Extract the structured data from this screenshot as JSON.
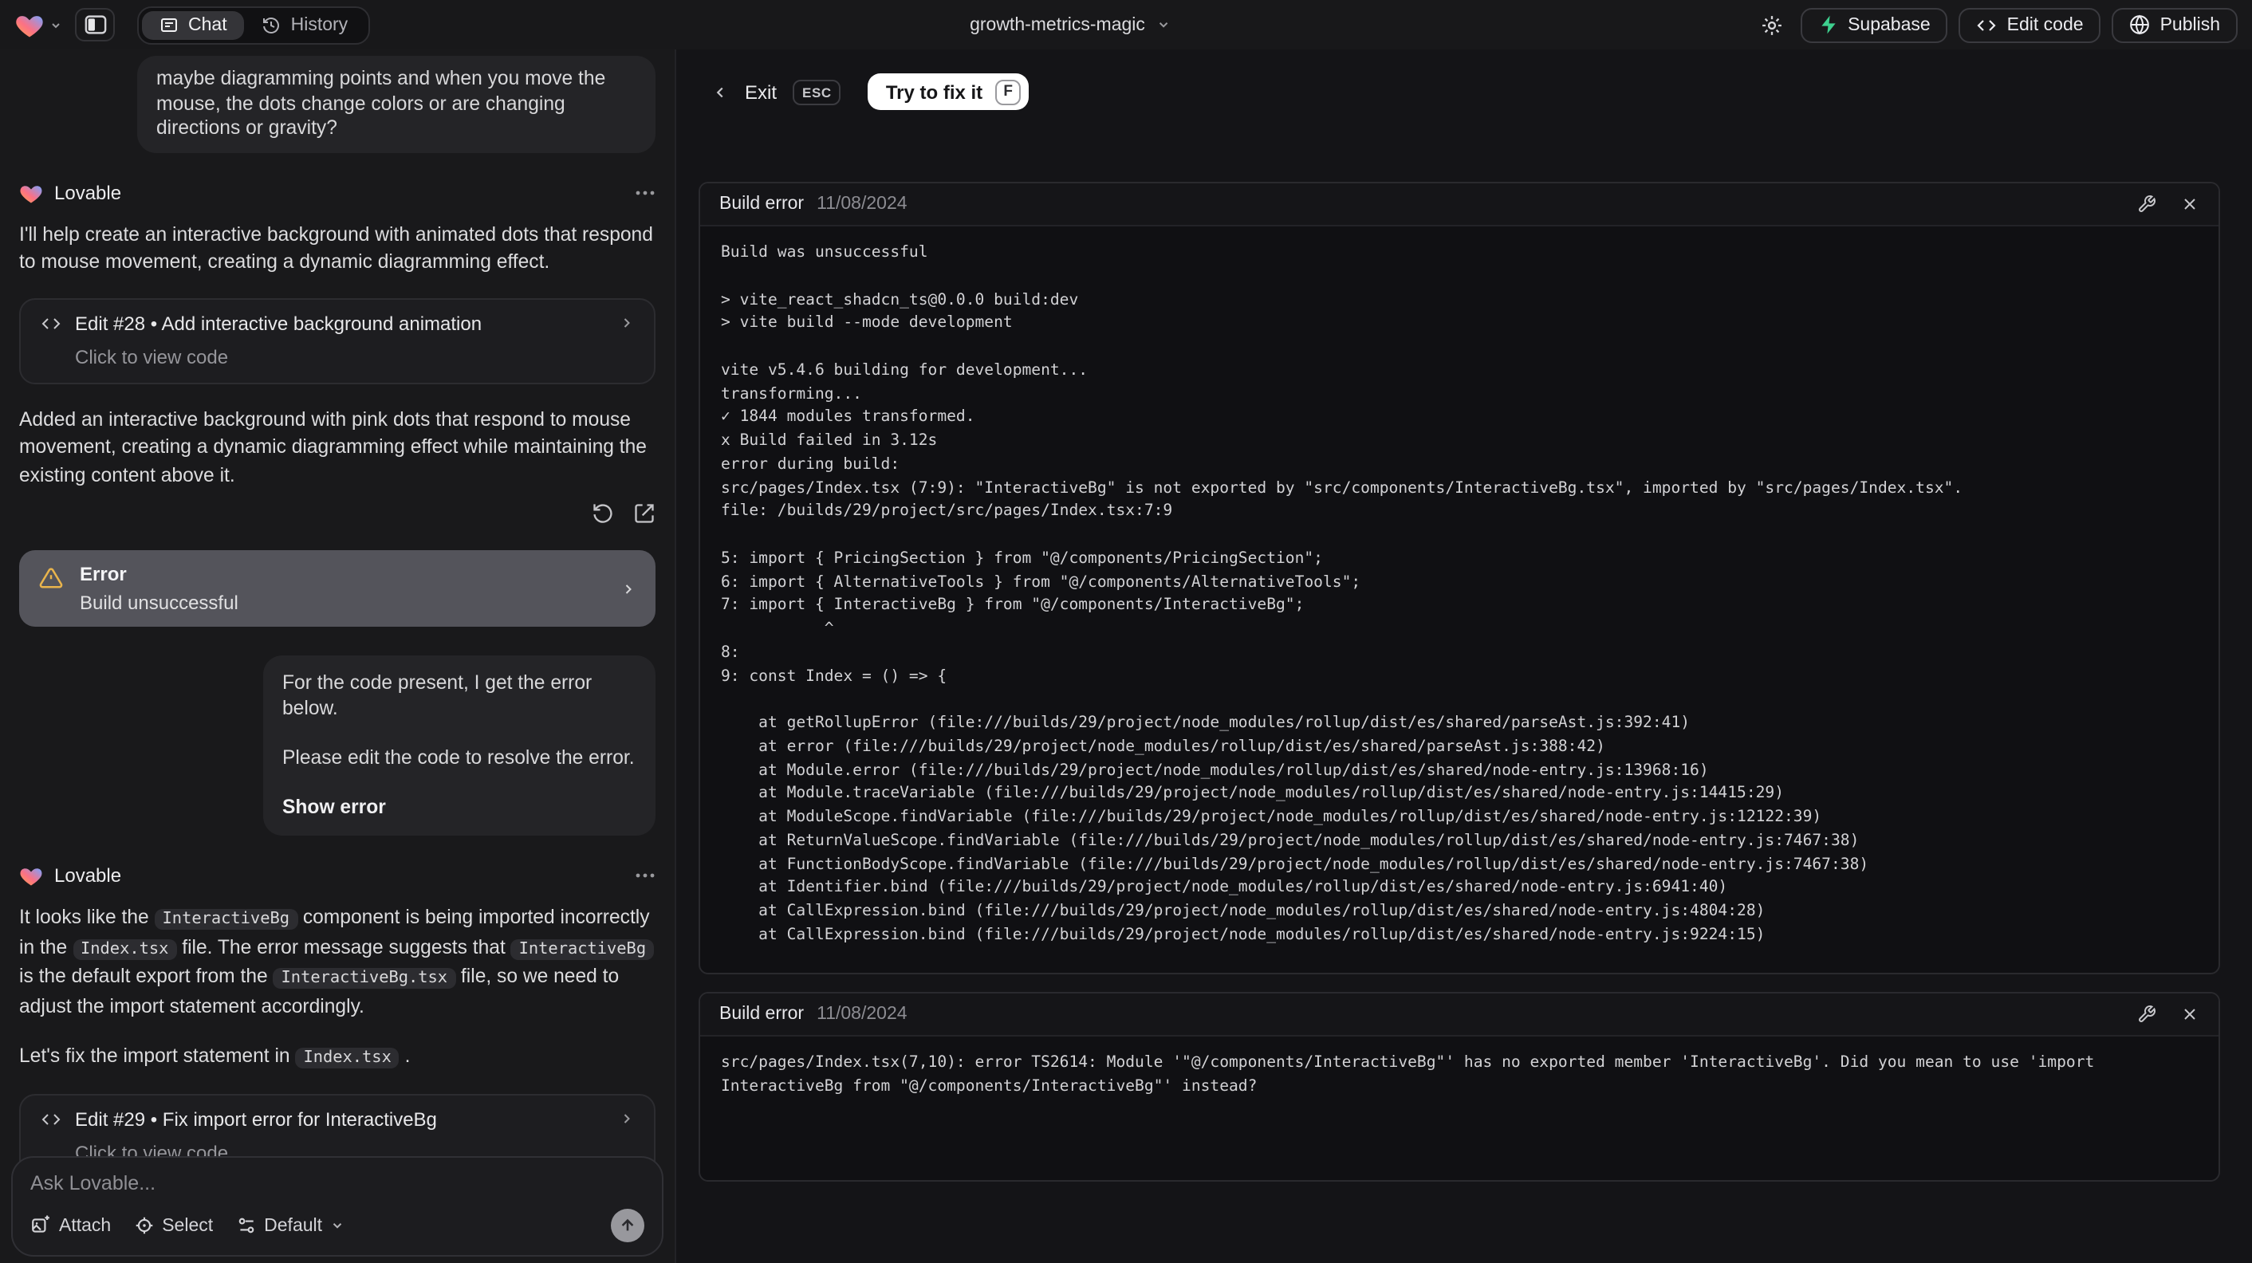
{
  "topbar": {
    "tabs": {
      "chat": "Chat",
      "history": "History"
    },
    "project_name": "growth-metrics-magic",
    "supabase_label": "Supabase",
    "edit_code_label": "Edit code",
    "publish_label": "Publish"
  },
  "colors": {
    "supabase_green": "#3ecf8e",
    "warning_amber": "#e9b44c",
    "fix_button_bg": "#ffffff"
  },
  "chat": {
    "assistant_name": "Lovable",
    "user_message_1": "maybe diagramming points and when you move the mouse, the dots change colors or are changing directions or gravity?",
    "assistant_message_1": {
      "intro": "I'll help create an interactive background with animated dots that respond to mouse movement, creating a dynamic diagramming effect.",
      "edit_title": "Edit #28 • Add interactive background animation",
      "edit_subtitle": "Click to view code",
      "summary": "Added an interactive background with pink dots that respond to mouse movement, creating a dynamic diagramming effect while maintaining the existing content above it."
    },
    "error_card": {
      "title": "Error",
      "subtitle": "Build unsuccessful"
    },
    "user_message_2": {
      "line1": "For the code present, I get the error below.",
      "line2": "Please edit the code to resolve the error.",
      "action": "Show error"
    },
    "assistant_message_2": {
      "parts": [
        "It looks like the ",
        "InteractiveBg",
        " component is being imported incorrectly in the ",
        "Index.tsx",
        " file. The error message suggests that ",
        "InteractiveBg",
        " is the default export from the ",
        "InteractiveBg.tsx",
        " file, so we need to adjust the import statement accordingly."
      ],
      "fix_parts": [
        "Let's fix the import statement in ",
        "Index.tsx",
        " ."
      ],
      "edit_title": "Edit #29 • Fix import error for InteractiveBg",
      "edit_subtitle": "Click to view code"
    },
    "composer": {
      "placeholder": "Ask Lovable...",
      "attach": "Attach",
      "select": "Select",
      "mode": "Default"
    }
  },
  "error_view": {
    "exit_label": "Exit",
    "esc_key": "ESC",
    "fix_label": "Try to fix it",
    "fix_key": "F",
    "panel_1": {
      "title": "Build error",
      "date": "11/08/2024",
      "log": "Build was unsuccessful\n\n> vite_react_shadcn_ts@0.0.0 build:dev\n> vite build --mode development\n\nvite v5.4.6 building for development...\ntransforming...\n✓ 1844 modules transformed.\nx Build failed in 3.12s\nerror during build:\nsrc/pages/Index.tsx (7:9): \"InteractiveBg\" is not exported by \"src/components/InteractiveBg.tsx\", imported by \"src/pages/Index.tsx\".\nfile: /builds/29/project/src/pages/Index.tsx:7:9\n\n5: import { PricingSection } from \"@/components/PricingSection\";\n6: import { AlternativeTools } from \"@/components/AlternativeTools\";\n7: import { InteractiveBg } from \"@/components/InteractiveBg\";\n           ^\n8: \n9: const Index = () => {\n\n    at getRollupError (file:///builds/29/project/node_modules/rollup/dist/es/shared/parseAst.js:392:41)\n    at error (file:///builds/29/project/node_modules/rollup/dist/es/shared/parseAst.js:388:42)\n    at Module.error (file:///builds/29/project/node_modules/rollup/dist/es/shared/node-entry.js:13968:16)\n    at Module.traceVariable (file:///builds/29/project/node_modules/rollup/dist/es/shared/node-entry.js:14415:29)\n    at ModuleScope.findVariable (file:///builds/29/project/node_modules/rollup/dist/es/shared/node-entry.js:12122:39)\n    at ReturnValueScope.findVariable (file:///builds/29/project/node_modules/rollup/dist/es/shared/node-entry.js:7467:38)\n    at FunctionBodyScope.findVariable (file:///builds/29/project/node_modules/rollup/dist/es/shared/node-entry.js:7467:38)\n    at Identifier.bind (file:///builds/29/project/node_modules/rollup/dist/es/shared/node-entry.js:6941:40)\n    at CallExpression.bind (file:///builds/29/project/node_modules/rollup/dist/es/shared/node-entry.js:4804:28)\n    at CallExpression.bind (file:///builds/29/project/node_modules/rollup/dist/es/shared/node-entry.js:9224:15)"
    },
    "panel_2": {
      "title": "Build error",
      "date": "11/08/2024",
      "log": "src/pages/Index.tsx(7,10): error TS2614: Module '\"@/components/InteractiveBg\"' has no exported member 'InteractiveBg'. Did you mean to use 'import\nInteractiveBg from \"@/components/InteractiveBg\"' instead?"
    }
  }
}
